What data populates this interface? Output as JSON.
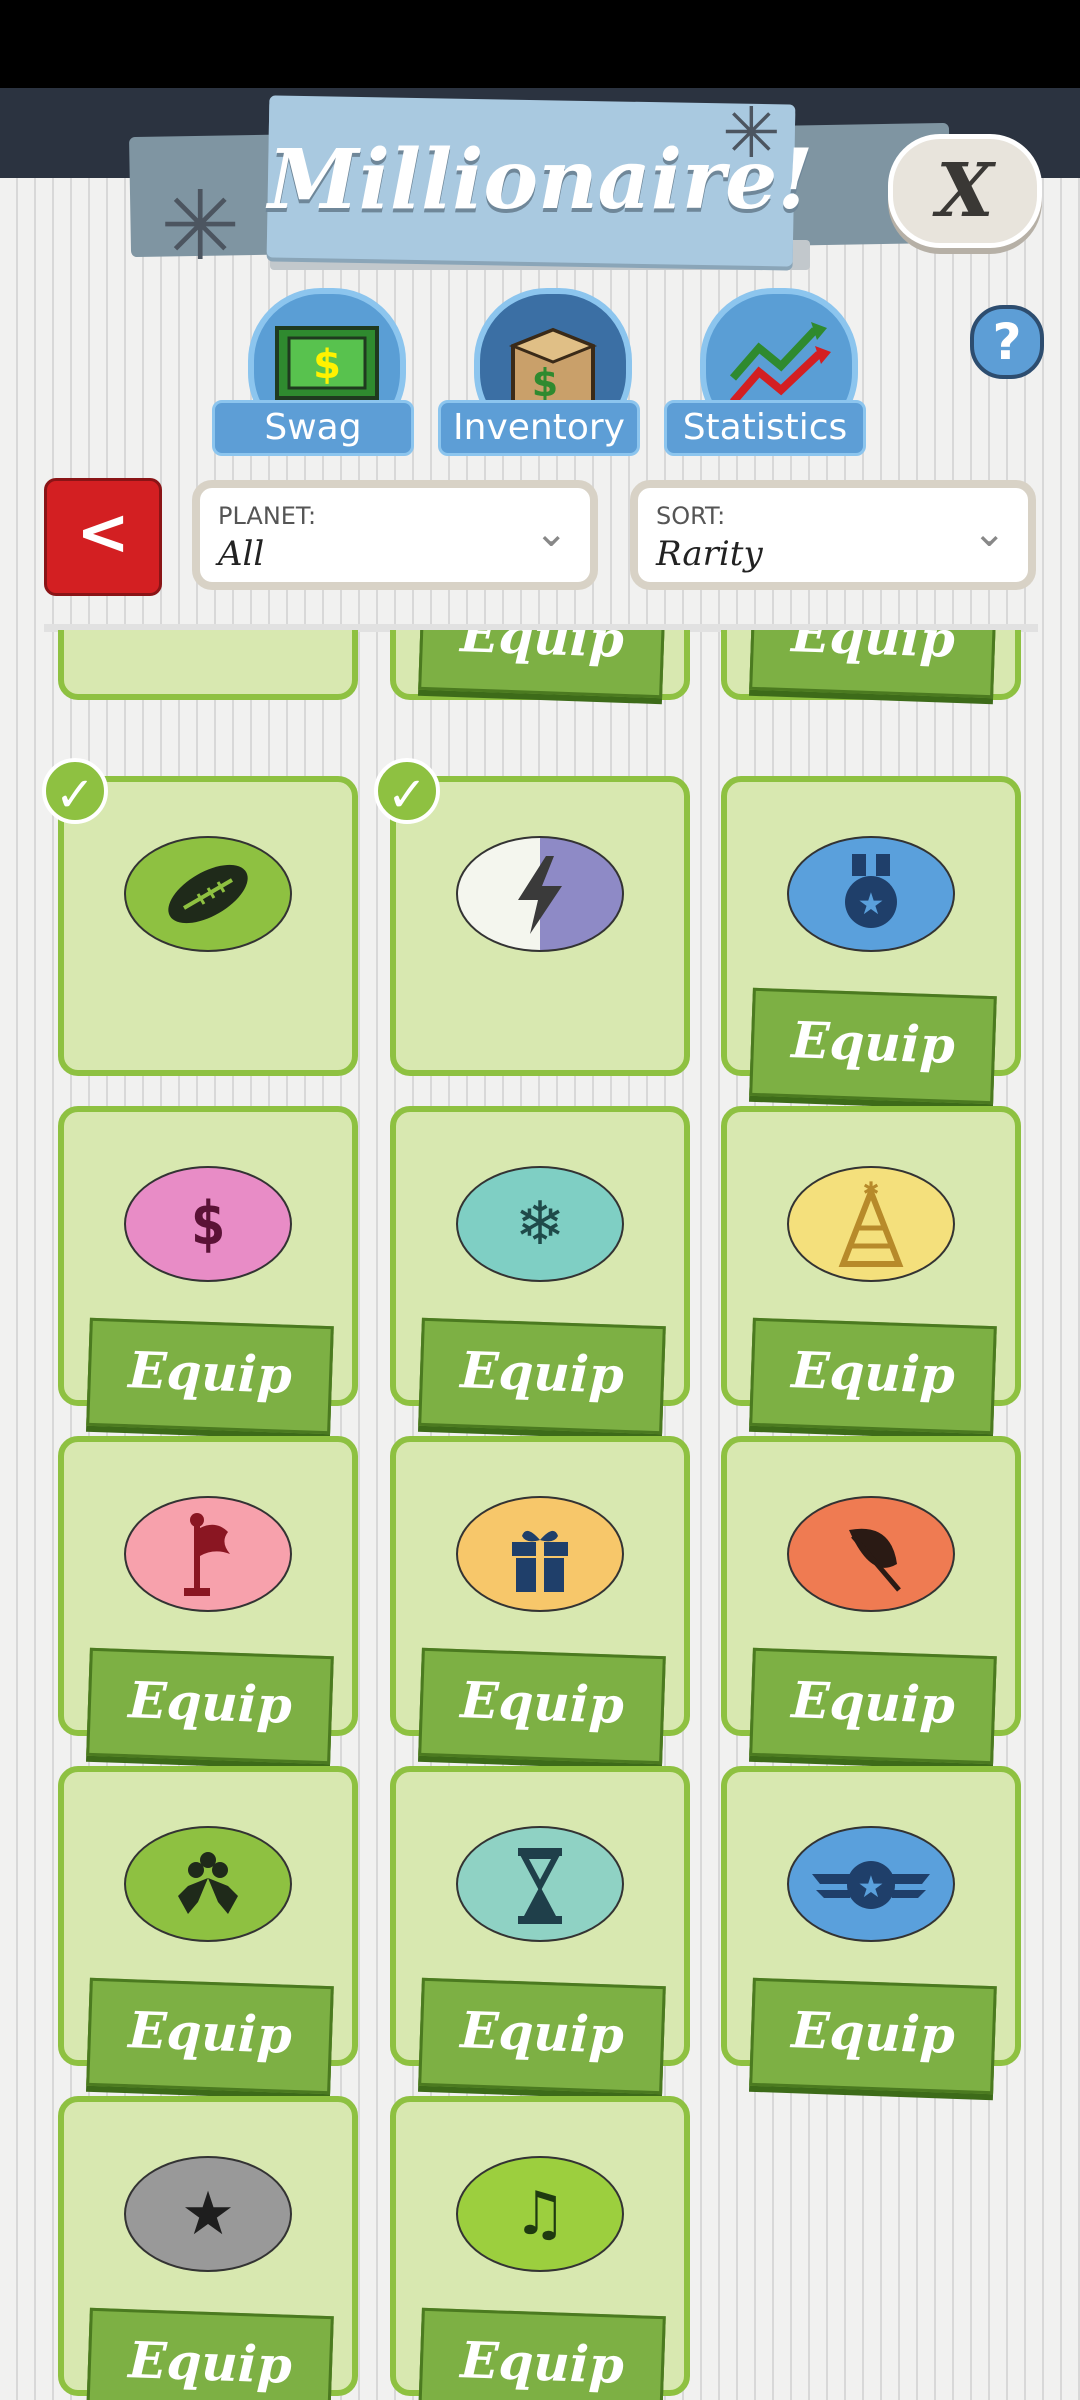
{
  "header": {
    "title": "Millionaire!",
    "close_label": "X",
    "help_label": "?"
  },
  "categories": [
    {
      "label": "Swag",
      "icon": "cash-icon"
    },
    {
      "label": "Inventory",
      "icon": "box-icon"
    },
    {
      "label": "Statistics",
      "icon": "chart-icon"
    }
  ],
  "filters": {
    "back_label": "<",
    "planet": {
      "label": "PLANET:",
      "value": "All"
    },
    "sort": {
      "label": "SORT:",
      "value": "Rarity"
    }
  },
  "items": {
    "equip_label": "Equip",
    "rows": [
      {
        "icons": [
          "football-icon",
          "lightning-icon",
          "medal-icon"
        ],
        "equipped": [
          true,
          true,
          false
        ]
      },
      {
        "icons": [
          "pixel-dollar-icon",
          "snowflake-icon",
          "party-hat-icon"
        ],
        "equipped": [
          false,
          false,
          false
        ]
      },
      {
        "icons": [
          "flag-icon",
          "gift-icon",
          "leaf-icon"
        ],
        "equipped": [
          false,
          false,
          false
        ]
      },
      {
        "icons": [
          "holly-icon",
          "hourglass-icon",
          "winged-star-icon"
        ],
        "equipped": [
          false,
          false,
          false
        ]
      },
      {
        "icons": [
          "star-icon",
          "music-note-icon"
        ],
        "equipped": [
          false,
          false
        ]
      }
    ]
  },
  "colors": {
    "tile_bg": "#d8e8b0",
    "tile_border": "#8ec141",
    "equip_btn": "#7db044",
    "header_blue": "#a9c9e0",
    "back_red": "#d31f22"
  }
}
